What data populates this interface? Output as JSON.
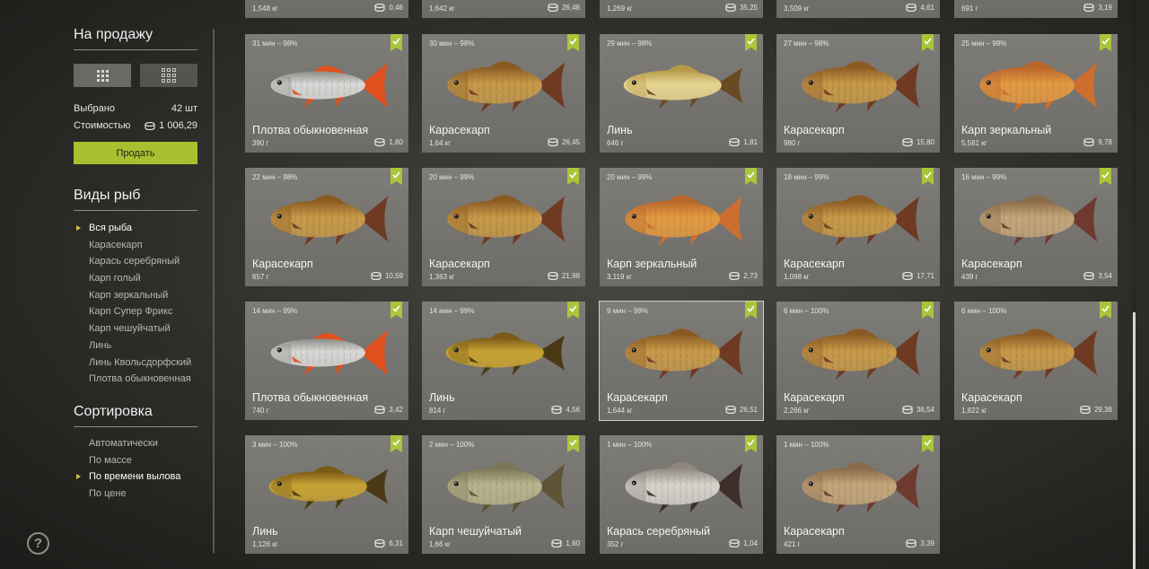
{
  "sidebar": {
    "sale_title": "На продажу",
    "selected_label": "Выбрано",
    "selected_value": "42 шт",
    "cost_label": "Стоимостью",
    "cost_value": "1 006,29",
    "sell_label": "Продать",
    "species_title": "Виды рыб",
    "species": [
      "Вся рыба",
      "Карасекарп",
      "Карась серебряный",
      "Карп голый",
      "Карп зеркальный",
      "Карп Супер Фрикс",
      "Карп чешуйчатый",
      "Линь",
      "Линь Квольсдорфский",
      "Плотва обыкновенная"
    ],
    "species_active": 0,
    "sort_title": "Сортировка",
    "sort": [
      "Автоматически",
      "По массе",
      "По времени вылова",
      "По цене"
    ],
    "sort_active": 2,
    "help": "?"
  },
  "top_row": [
    {
      "weight": "1,548 кг",
      "price": "0,46"
    },
    {
      "weight": "1,642 кг",
      "price": "26,48"
    },
    {
      "weight": "1,269 кг",
      "price": "35,25"
    },
    {
      "weight": "3,509 кг",
      "price": "4,61"
    },
    {
      "weight": "691 г",
      "price": "3,19"
    }
  ],
  "cards": [
    {
      "time": "31 мин – 98%",
      "name": "Плотва обыкновенная",
      "weight": "390 г",
      "price": "1,80",
      "fish": "roach"
    },
    {
      "time": "30 мин – 98%",
      "name": "Карасекарп",
      "weight": "1,64 кг",
      "price": "26,45",
      "fish": "hybrid"
    },
    {
      "time": "29 мин – 98%",
      "name": "Линь",
      "weight": "646 г",
      "price": "1,81",
      "fish": "tench-light"
    },
    {
      "time": "27 мин – 98%",
      "name": "Карасекарп",
      "weight": "980 г",
      "price": "15,80",
      "fish": "hybrid"
    },
    {
      "time": "25 мин – 98%",
      "name": "Карп зеркальный",
      "weight": "5,581 кг",
      "price": "9,78",
      "fish": "mirror"
    },
    {
      "time": "22 мин – 98%",
      "name": "Карасекарп",
      "weight": "657 г",
      "price": "10,59",
      "fish": "hybrid"
    },
    {
      "time": "20 мин – 99%",
      "name": "Карасекарп",
      "weight": "1,363 кг",
      "price": "21,98",
      "fish": "hybrid"
    },
    {
      "time": "20 мин – 99%",
      "name": "Карп зеркальный",
      "weight": "3,119 кг",
      "price": "2,73",
      "fish": "mirror"
    },
    {
      "time": "18 мин – 99%",
      "name": "Карасекарп",
      "weight": "1,098 кг",
      "price": "17,71",
      "fish": "hybrid"
    },
    {
      "time": "16 мин – 99%",
      "name": "Карасекарп",
      "weight": "439 г",
      "price": "3,54",
      "fish": "hybrid-pale"
    },
    {
      "time": "14 мин – 99%",
      "name": "Плотва обыкновенная",
      "weight": "740 г",
      "price": "3,42",
      "fish": "roach"
    },
    {
      "time": "14 мин – 99%",
      "name": "Линь",
      "weight": "814 г",
      "price": "4,56",
      "fish": "tench"
    },
    {
      "time": "9 мин – 99%",
      "name": "Карасекарп",
      "weight": "1,644 кг",
      "price": "26,51",
      "fish": "hybrid",
      "selected": true
    },
    {
      "time": "6 мин – 100%",
      "name": "Карасекарп",
      "weight": "2,266 кг",
      "price": "36,54",
      "fish": "hybrid"
    },
    {
      "time": "6 мин – 100%",
      "name": "Карасекарп",
      "weight": "1,822 кг",
      "price": "29,38",
      "fish": "hybrid"
    },
    {
      "time": "3 мин – 100%",
      "name": "Линь",
      "weight": "1,126 кг",
      "price": "6,31",
      "fish": "tench"
    },
    {
      "time": "2 мин – 100%",
      "name": "Карп чешуйчатый",
      "weight": "1,66 кг",
      "price": "1,60",
      "fish": "scaly"
    },
    {
      "time": "1 мин – 100%",
      "name": "Карась серебряный",
      "weight": "352 г",
      "price": "1,04",
      "fish": "silver"
    },
    {
      "time": "1 мин – 100%",
      "name": "Карасекарп",
      "weight": "421 г",
      "price": "3,39",
      "fish": "hybrid-pale"
    }
  ],
  "colors": {
    "accent": "#a9bf2f",
    "check": "#a9c63a",
    "fish": {
      "hybrid": [
        "#c79a4a",
        "#8a5a22",
        "#6e3a22"
      ],
      "hybrid-pale": [
        "#c4a67c",
        "#8a6a48",
        "#6e3a30"
      ],
      "roach": [
        "#d8d8d6",
        "#8a8a86",
        "#e0501e"
      ],
      "tench": [
        "#c7a132",
        "#7a5a18",
        "#4a3a14"
      ],
      "tench-light": [
        "#e6d590",
        "#b69a48",
        "#6a4a22"
      ],
      "mirror": [
        "#e29a42",
        "#b8652a",
        "#cc6e30"
      ],
      "scaly": [
        "#b8b48e",
        "#7a7656",
        "#5e5436"
      ],
      "silver": [
        "#d6d2cc",
        "#8e8880",
        "#3e2e2a"
      ]
    }
  }
}
